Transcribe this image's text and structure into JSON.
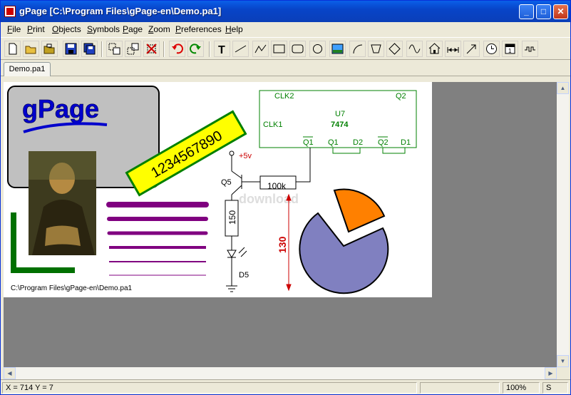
{
  "window": {
    "title": "gPage [C:\\Program Files\\gPage-en\\Demo.pa1]"
  },
  "menu": [
    "File",
    "Print",
    "Objects",
    "Symbols",
    "Page",
    "Zoom",
    "Preferences",
    "Help"
  ],
  "toolbar_icons": [
    "new-icon",
    "open-icon",
    "open-folder-icon",
    "save-icon",
    "save-all-icon",
    "copy-page-icon",
    "paste-page-icon",
    "delete-page-icon",
    "undo-icon",
    "redo-icon",
    "text-icon",
    "line-icon",
    "polyline-icon",
    "rectangle-icon",
    "rounded-rectangle-icon",
    "circle-icon",
    "image-icon",
    "arc-icon",
    "polygon-icon",
    "diamond-icon",
    "sine-wave-icon",
    "house-icon",
    "dimension-icon",
    "arrow-icon",
    "clock-icon",
    "calendar-icon",
    "signal-icon"
  ],
  "tabs": [
    {
      "label": "Demo.pa1"
    }
  ],
  "page": {
    "logo_text": "gPage",
    "number_banner": "1234567890",
    "file_path": "C:\\Program Files\\gPage-en\\Demo.pa1",
    "circuit": {
      "chip_ref": "U7",
      "chip_part": "7474",
      "clk2": "CLK2",
      "clk1": "CLK1",
      "q2": "Q2",
      "q1_bar": "Q1",
      "q1": "Q1",
      "d2": "D2",
      "q2_bar": "Q2",
      "d1": "D1",
      "supply": "+5v",
      "transistor": "Q5",
      "resistor1": "100k",
      "resistor2": "150",
      "diode": "D5",
      "dimension": "130"
    },
    "watermark": "download",
    "colors": {
      "logo": "#0000cc",
      "banner": "#ffff00",
      "lines": "#800080",
      "pie_big": "#8080c0",
      "pie_small": "#ff8000",
      "circuit": "#008000",
      "red": "#cc0000"
    }
  },
  "status": {
    "coords": "X = 714   Y = 7",
    "zoom": "100%",
    "mode": "S"
  }
}
